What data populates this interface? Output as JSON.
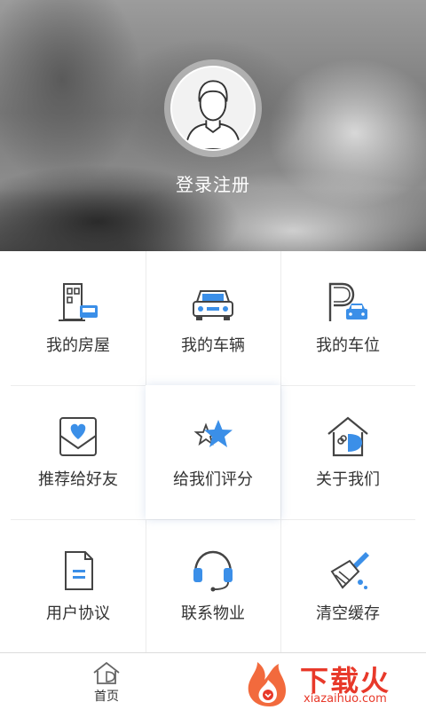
{
  "profile": {
    "login_label": "登录注册"
  },
  "menu": [
    {
      "label": "我的房屋",
      "icon": "house-sofa-icon"
    },
    {
      "label": "我的车辆",
      "icon": "car-icon"
    },
    {
      "label": "我的车位",
      "icon": "parking-icon"
    },
    {
      "label": "推荐给好友",
      "icon": "heart-mail-icon"
    },
    {
      "label": "给我们评分",
      "icon": "star-icon"
    },
    {
      "label": "关于我们",
      "icon": "about-house-icon"
    },
    {
      "label": "用户协议",
      "icon": "document-icon"
    },
    {
      "label": "联系物业",
      "icon": "headset-icon"
    },
    {
      "label": "清空缓存",
      "icon": "broom-icon"
    }
  ],
  "tabbar": {
    "home_label": "首页"
  },
  "watermark": {
    "text": "下载火",
    "domain": "xiazaihuo.com"
  },
  "colors": {
    "accent": "#3b8fe8",
    "outline": "#444444",
    "brand_red": "#e8392a"
  }
}
